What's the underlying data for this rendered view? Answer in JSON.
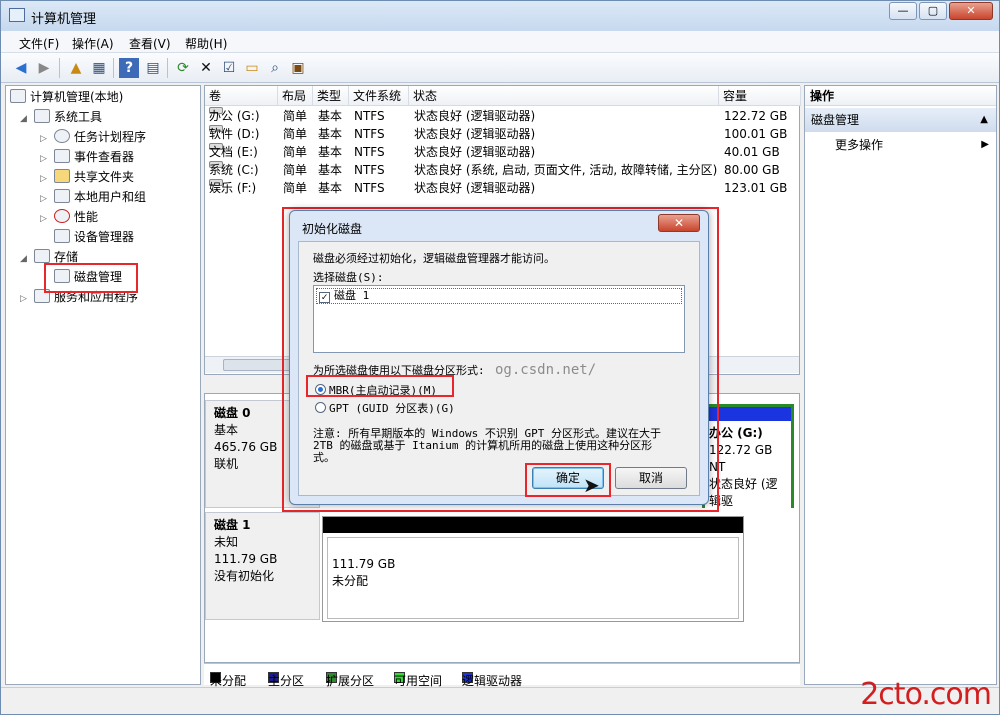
{
  "window": {
    "title": "计算机管理",
    "btn_min": "—",
    "btn_max": "▢",
    "btn_close": "✕"
  },
  "menu": [
    "文件(F)",
    "操作(A)",
    "查看(V)",
    "帮助(H)"
  ],
  "tree": {
    "root": "计算机管理(本地)",
    "system_tools": "系统工具",
    "task_scheduler": "任务计划程序",
    "event_viewer": "事件查看器",
    "shared_folders": "共享文件夹",
    "local_users": "本地用户和组",
    "performance": "性能",
    "device_manager": "设备管理器",
    "storage": "存储",
    "disk_management": "磁盘管理",
    "services": "服务和应用程序"
  },
  "columns": [
    "卷",
    "布局",
    "类型",
    "文件系统",
    "状态",
    "容量"
  ],
  "volumes": [
    {
      "name": "办公 (G:)",
      "layout": "简单",
      "type": "基本",
      "fs": "NTFS",
      "status": "状态良好 (逻辑驱动器)",
      "capacity": "122.72 GB"
    },
    {
      "name": "软件 (D:)",
      "layout": "简单",
      "type": "基本",
      "fs": "NTFS",
      "status": "状态良好 (逻辑驱动器)",
      "capacity": "100.01 GB"
    },
    {
      "name": "文档 (E:)",
      "layout": "简单",
      "type": "基本",
      "fs": "NTFS",
      "status": "状态良好 (逻辑驱动器)",
      "capacity": "40.01 GB"
    },
    {
      "name": "系统 (C:)",
      "layout": "简单",
      "type": "基本",
      "fs": "NTFS",
      "status": "状态良好 (系统, 启动, 页面文件, 活动, 故障转储, 主分区)",
      "capacity": "80.00 GB"
    },
    {
      "name": "娱乐 (F:)",
      "layout": "简单",
      "type": "基本",
      "fs": "NTFS",
      "status": "状态良好 (逻辑驱动器)",
      "capacity": "123.01 GB"
    }
  ],
  "disk0": {
    "name": "磁盘 0",
    "type": "基本",
    "size": "465.76 GB",
    "state": "联机",
    "partition_name": "办公 (G:)",
    "partition_size": "122.72 GB NT",
    "partition_status": "状态良好 (逻辑驱"
  },
  "disk1": {
    "name": "磁盘 1",
    "type": "未知",
    "size": "111.79 GB",
    "state": "没有初始化",
    "area_size": "111.79 GB",
    "area_state": "未分配"
  },
  "legend": [
    "未分配",
    "主分区",
    "扩展分区",
    "可用空间",
    "逻辑驱动器"
  ],
  "legend_colors": [
    "#000000",
    "#1a1a8c",
    "#2f8a2f",
    "#33dd33",
    "#1a35e0"
  ],
  "actions": {
    "header": "操作",
    "section": "磁盘管理",
    "more": "更多操作"
  },
  "dialog": {
    "title": "初始化磁盘",
    "close": "✕",
    "desc": "磁盘必须经过初始化，逻辑磁盘管理器才能访问。",
    "select_label": "选择磁盘(S):",
    "disk_item": "磁盘 1",
    "style_label": "为所选磁盘使用以下磁盘分区形式:",
    "watermark_text": "og.csdn.net/",
    "mbr": "MBR(主启动记录)(M)",
    "gpt": "GPT (GUID 分区表)(G)",
    "note": "注意: 所有早期版本的 Windows 不识别 GPT 分区形式。建议在大于",
    "note2": "2TB 的磁盘或基于 Itanium 的计算机所用的磁盘上使用这种分区形",
    "note3": "式。",
    "ok": "确定",
    "cancel": "取消"
  },
  "watermark": "2cto.com"
}
